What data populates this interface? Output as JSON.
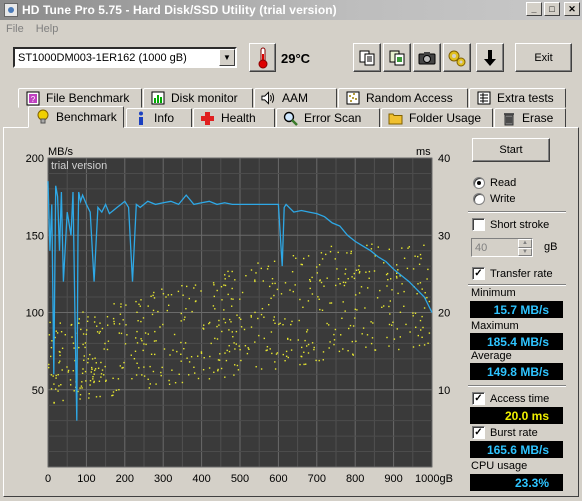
{
  "window": {
    "title": "HD Tune Pro 5.75 - Hard Disk/SSD Utility (trial version)"
  },
  "menu": {
    "file": "File",
    "help": "Help"
  },
  "toolbar": {
    "drive": "ST1000DM003-1ER162 (1000 gB)",
    "temperature": "29°C",
    "exit_label": "Exit"
  },
  "tabs_top": [
    {
      "label": "File Benchmark"
    },
    {
      "label": "Disk monitor"
    },
    {
      "label": "AAM"
    },
    {
      "label": "Random Access"
    },
    {
      "label": "Extra tests"
    }
  ],
  "tabs_bottom": [
    {
      "label": "Benchmark"
    },
    {
      "label": "Info"
    },
    {
      "label": "Health"
    },
    {
      "label": "Error Scan"
    },
    {
      "label": "Folder Usage"
    },
    {
      "label": "Erase"
    }
  ],
  "controls": {
    "start_label": "Start",
    "read_label": "Read",
    "write_label": "Write",
    "short_stroke_label": "Short stroke",
    "short_stroke_value": "40",
    "short_stroke_unit": "gB",
    "transfer_rate_label": "Transfer rate",
    "access_time_label": "Access time",
    "burst_rate_label": "Burst rate",
    "cpu_usage_label": "CPU usage"
  },
  "results": {
    "minimum_label": "Minimum",
    "minimum": "15.7 MB/s",
    "maximum_label": "Maximum",
    "maximum": "185.4 MB/s",
    "average_label": "Average",
    "average": "149.8 MB/s",
    "access_time": "20.0 ms",
    "burst_rate": "165.6 MB/s",
    "cpu_usage": "23.3%"
  },
  "colors": {
    "transfer_line": "#2ea8e6",
    "access_dots": "#e8e830",
    "chart_bg": "#3a3a3a",
    "value_cyan": "#2ec4ff",
    "value_yellow": "#f0f000"
  },
  "chart_data": {
    "type": "line",
    "watermark": "trial version",
    "y_left_unit": "MB/s",
    "y_right_unit": "ms",
    "x_unit": "1000gB",
    "ylim_left": [
      0,
      200
    ],
    "ylim_right": [
      0,
      40
    ],
    "xlim": [
      0,
      1000
    ],
    "x_ticks": [
      0,
      100,
      200,
      300,
      400,
      500,
      600,
      700,
      800,
      900
    ],
    "y_left_ticks": [
      50,
      100,
      150,
      200
    ],
    "y_right_ticks": [
      10,
      20,
      30,
      40
    ],
    "grid": true,
    "transfer_rate": {
      "x": [
        0,
        5,
        10,
        15,
        20,
        25,
        30,
        35,
        40,
        50,
        60,
        65,
        70,
        75,
        78,
        80,
        85,
        90,
        100,
        110,
        120,
        130,
        140,
        150,
        160,
        170,
        180,
        190,
        200,
        210,
        220,
        230,
        240,
        260,
        280,
        300,
        320,
        340,
        360,
        380,
        400,
        420,
        440,
        460,
        480,
        500,
        520,
        540,
        560,
        580,
        600,
        610,
        615,
        620,
        640,
        660,
        680,
        700,
        720,
        740,
        760,
        780,
        800,
        820,
        840,
        860,
        880,
        900,
        920,
        940,
        960,
        980,
        1000
      ],
      "values": [
        185,
        140,
        170,
        60,
        182,
        175,
        140,
        178,
        120,
        165,
        150,
        178,
        100,
        30,
        150,
        178,
        172,
        176,
        170,
        165,
        120,
        168,
        165,
        170,
        164,
        166,
        168,
        170,
        172,
        168,
        120,
        170,
        168,
        172,
        170,
        171,
        172,
        170,
        176,
        170,
        171,
        172,
        170,
        171,
        170,
        170,
        170,
        170,
        170,
        170,
        170,
        130,
        168,
        170,
        165,
        166,
        165,
        164,
        162,
        158,
        156,
        150,
        146,
        143,
        140,
        136,
        133,
        128,
        124,
        120,
        115,
        110,
        100
      ]
    },
    "access_time_ms_range": [
      8,
      29
    ]
  }
}
